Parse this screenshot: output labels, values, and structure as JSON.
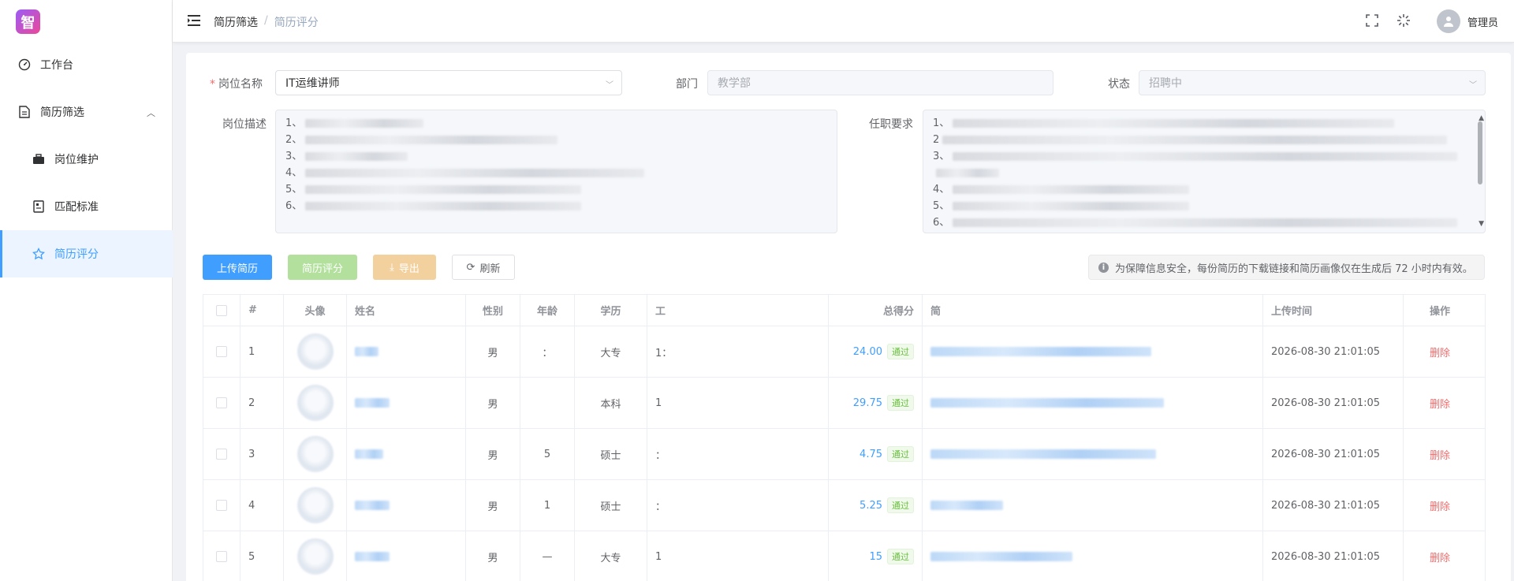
{
  "logo": {
    "char": "智"
  },
  "sidebar": {
    "items": [
      {
        "label": "工作台",
        "icon": "dashboard-icon"
      },
      {
        "label": "简历筛选",
        "icon": "document-icon"
      },
      {
        "label": "岗位维护",
        "icon": "briefcase-icon"
      },
      {
        "label": "匹配标准",
        "icon": "checklist-icon"
      },
      {
        "label": "简历评分",
        "icon": "star-icon",
        "active": true
      }
    ]
  },
  "header": {
    "breadcrumb": [
      "简历筛选",
      "简历评分"
    ],
    "breadcrumb_sep": "/",
    "user_name": "管理员"
  },
  "form": {
    "position_label": "岗位名称",
    "position_value": "IT运维讲师",
    "dept_label": "部门",
    "dept_placeholder": "教学部",
    "status_label": "状态",
    "status_value": "招聘中",
    "desc_label": "岗位描述",
    "req_label": "任职要求",
    "desc_lines": [
      "1、",
      "2、",
      "3、",
      "4、",
      "5、",
      "6、"
    ],
    "req_lines": [
      "1、",
      "2",
      "3、",
      "",
      "4、",
      "5、",
      "6、"
    ]
  },
  "toolbar": {
    "upload": "上传简历",
    "score": "简历评分",
    "export": "导出",
    "refresh": "刷新",
    "notice": "为保障信息安全，每份简历的下载链接和简历画像仅在生成后 72 小时内有效。"
  },
  "table": {
    "headers": [
      "#",
      "头像",
      "姓名",
      "性别",
      "年龄",
      "学历",
      "工",
      "总得分",
      "简",
      "上传时间",
      "操作"
    ],
    "rows": [
      {
        "idx": "1",
        "sex": "男",
        "age": "：",
        "edu": "大专",
        "work": "1：",
        "score": "24.00",
        "tag": "通过",
        "time": "2026-08-30 21:01:05",
        "op": "删除"
      },
      {
        "idx": "2",
        "sex": "男",
        "age": "",
        "edu": "本科",
        "work": "1",
        "score": "29.75",
        "tag": "通过",
        "time": "2026-08-30 21:01:05",
        "op": "删除"
      },
      {
        "idx": "3",
        "sex": "男",
        "age": "5",
        "edu": "硕士",
        "work": "：",
        "score": "4.75",
        "tag": "通过",
        "time": "2026-08-30 21:01:05",
        "op": "删除"
      },
      {
        "idx": "4",
        "sex": "男",
        "age": "1",
        "edu": "硕士",
        "work": "：",
        "score": "5.25",
        "tag": "通过",
        "time": "2026-08-30 21:01:05",
        "op": "删除"
      },
      {
        "idx": "5",
        "sex": "男",
        "age": "—",
        "edu": "大专",
        "work": "1",
        "score": "15",
        "tag": "通过",
        "time": "2026-08-30 21:01:05",
        "op": "删除"
      }
    ]
  },
  "colors": {
    "primary": "#409eff",
    "danger": "#f56c6c",
    "success": "#67c23a"
  }
}
